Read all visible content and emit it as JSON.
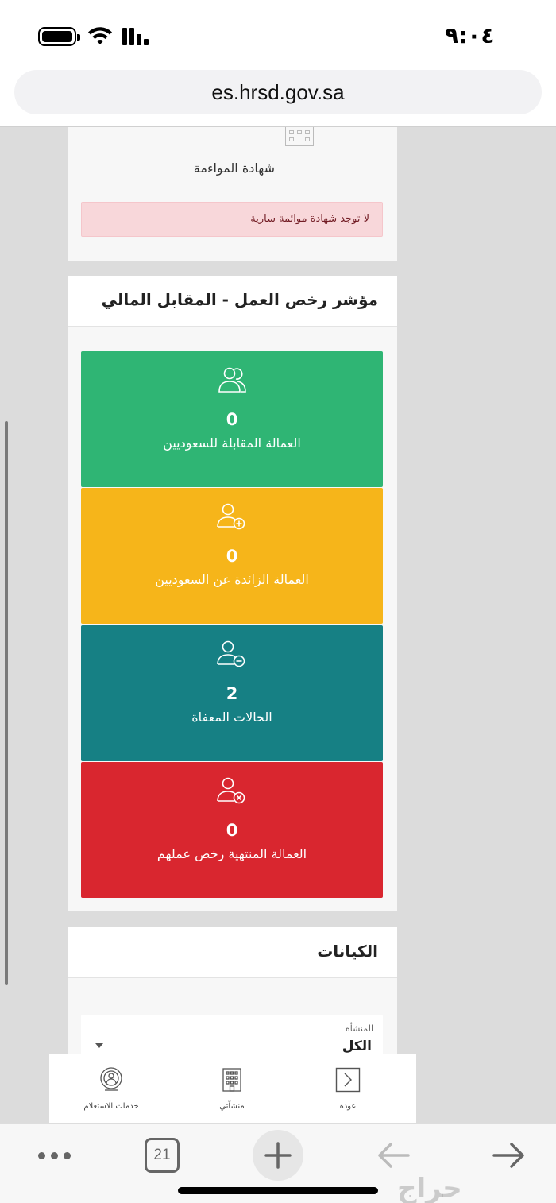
{
  "status_bar": {
    "time": "٩:٠٤"
  },
  "browser": {
    "url": "es.hrsd.gov.sa",
    "tab_count": "21"
  },
  "certificate": {
    "title": "شهادة المواءمة",
    "alert_text": "لا توجد شهادة موائمة سارية"
  },
  "work_permits": {
    "title": "مؤشر رخص العمل - المقابل المالي",
    "tiles": [
      {
        "value": "0",
        "label": "العمالة المقابلة للسعوديين",
        "icon": "users-icon",
        "color": "#2fb574"
      },
      {
        "value": "0",
        "label": "العمالة الزائدة عن السعوديين",
        "icon": "user-plus-icon",
        "color": "#f6b51a"
      },
      {
        "value": "2",
        "label": "الحالات المعفاة",
        "icon": "user-minus-icon",
        "color": "#168084"
      },
      {
        "value": "0",
        "label": "العمالة المنتهية رخص عملهم",
        "icon": "user-x-icon",
        "color": "#d9262f"
      }
    ]
  },
  "entities": {
    "title": "الكيانات",
    "select_label": "المنشأة",
    "select_value": "الكل"
  },
  "app_nav": {
    "back_label": "عودة",
    "org_label": "منشآتي",
    "services_label": "خدمات الاستعلام"
  },
  "watermark": "حراج"
}
